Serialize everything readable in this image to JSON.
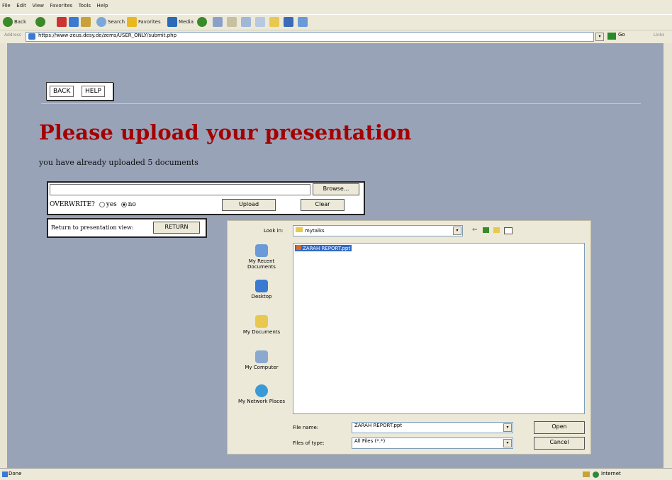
{
  "browser": {
    "menu": [
      "File",
      "Edit",
      "View",
      "Favorites",
      "Tools",
      "Help"
    ],
    "toolbar": {
      "back_label": "Back",
      "search_label": "Search",
      "favorites_label": "Favorites",
      "media_label": "Media"
    },
    "address": {
      "label": "Address",
      "url": "https://www-zeus.desy.de/zems/USER_ONLY/submit.php",
      "go_label": "Go",
      "links_label": "Links"
    },
    "status": {
      "text": "Done",
      "zone": "Internet"
    }
  },
  "page": {
    "nav": {
      "back_label": "BACK",
      "help_label": "HELP"
    },
    "title": "Please upload your presentation",
    "subtitle": "you have already uploaded 5 documents",
    "upload_form": {
      "file_value": "",
      "browse_label": "Browse...",
      "overwrite_label": "OVERWRITE?",
      "yes_label": "yes",
      "no_label": "no",
      "selected": "no",
      "upload_label": "Upload",
      "clear_label": "Clear"
    },
    "return_form": {
      "label": "Return to presentation view:",
      "button_label": "RETURN"
    }
  },
  "dialog": {
    "look_in_label": "Look in:",
    "look_in_value": "mytalks",
    "places": [
      {
        "label": "My Recent Documents",
        "icon": "recent-documents-icon"
      },
      {
        "label": "Desktop",
        "icon": "desktop-icon"
      },
      {
        "label": "My Documents",
        "icon": "my-documents-icon"
      },
      {
        "label": "My Computer",
        "icon": "my-computer-icon"
      },
      {
        "label": "My Network Places",
        "icon": "network-places-icon"
      }
    ],
    "files": [
      {
        "name": "ZARAH REPORT.ppt",
        "selected": true
      }
    ],
    "file_name_label": "File name:",
    "file_name_value": "ZARAH REPORT.ppt",
    "file_type_label": "Files of type:",
    "file_type_value": "All Files (*.*)",
    "open_label": "Open",
    "cancel_label": "Cancel"
  }
}
